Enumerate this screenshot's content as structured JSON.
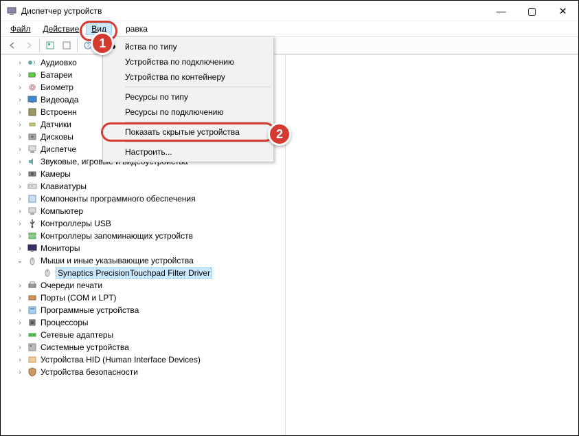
{
  "title": "Диспетчер устройств",
  "window_controls": {
    "min": "—",
    "max": "▢",
    "close": "✕"
  },
  "menubar": {
    "file": "Файл",
    "action": "Действие",
    "view": "Вид",
    "help": "равка"
  },
  "view_menu": {
    "by_type": "йства по типу",
    "by_connection": "Устройства по подключению",
    "by_container": "Устройства по контейнеру",
    "res_type": "Ресурсы по типу",
    "res_conn": "Ресурсы по подключению",
    "show_hidden": "Показать скрытые устройства",
    "customize": "Настроить..."
  },
  "callouts": {
    "one": "1",
    "two": "2"
  },
  "tree": [
    {
      "icon": "audio",
      "label": "Аудиовхо"
    },
    {
      "icon": "battery",
      "label": "Батареи"
    },
    {
      "icon": "biometric",
      "label": "Биометр"
    },
    {
      "icon": "display",
      "label": "Видеоада"
    },
    {
      "icon": "firmware",
      "label": "Встроенн"
    },
    {
      "icon": "sensor",
      "label": "Датчики"
    },
    {
      "icon": "disk",
      "label": "Дисковы"
    },
    {
      "icon": "computer",
      "label": "Диспетче"
    },
    {
      "icon": "audio2",
      "label": "Звуковые, игровые и видеоустройства"
    },
    {
      "icon": "camera",
      "label": "Камеры"
    },
    {
      "icon": "keyboard",
      "label": "Клавиатуры"
    },
    {
      "icon": "software",
      "label": "Компоненты программного обеспечения"
    },
    {
      "icon": "computer2",
      "label": "Компьютер"
    },
    {
      "icon": "usb",
      "label": "Контроллеры USB"
    },
    {
      "icon": "storage",
      "label": "Контроллеры запоминающих устройств"
    },
    {
      "icon": "monitor",
      "label": "Мониторы"
    },
    {
      "icon": "mouse",
      "label": "Мыши и иные указывающие устройства",
      "expanded": true,
      "children": [
        {
          "icon": "mouse",
          "label": "Synaptics PrecisionTouchpad Filter Driver",
          "selected": true
        }
      ]
    },
    {
      "icon": "printer",
      "label": "Очереди печати"
    },
    {
      "icon": "port",
      "label": "Порты (COM и LPT)"
    },
    {
      "icon": "program",
      "label": "Программные устройства"
    },
    {
      "icon": "cpu",
      "label": "Процессоры"
    },
    {
      "icon": "network",
      "label": "Сетевые адаптеры"
    },
    {
      "icon": "system",
      "label": "Системные устройства"
    },
    {
      "icon": "hid",
      "label": "Устройства HID (Human Interface Devices)"
    },
    {
      "icon": "security",
      "label": "Устройства безопасности"
    }
  ]
}
